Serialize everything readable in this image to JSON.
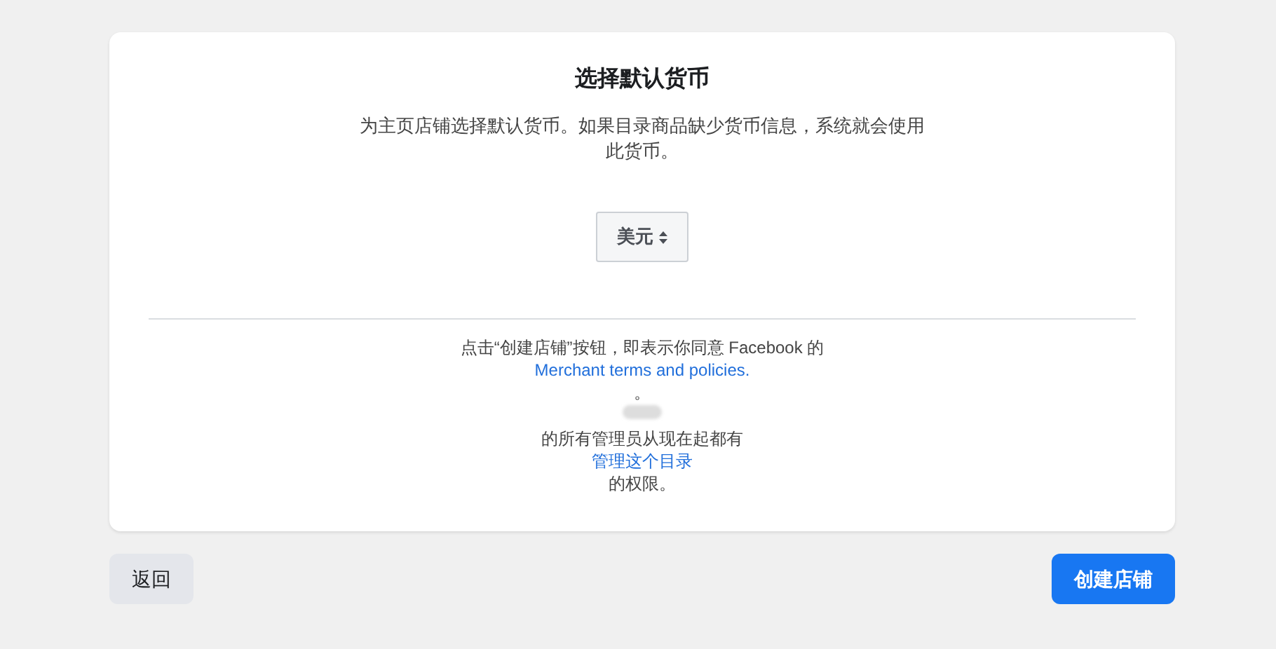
{
  "dialog": {
    "title": "选择默认货币",
    "description": "为主页店铺选择默认货币。如果目录商品缺少货币信息，系统就会使用此货币。",
    "currency_select": {
      "value": "美元"
    },
    "terms": [
      {
        "kind": "text",
        "text": "点击“创建店铺”按钮，即表示你同意 Facebook 的"
      },
      {
        "kind": "link",
        "text": "Merchant terms and policies."
      },
      {
        "kind": "text",
        "text": "。"
      },
      {
        "kind": "redacted"
      },
      {
        "kind": "text",
        "text": "的所有管理员从现在起都有"
      },
      {
        "kind": "link",
        "text": "管理这个目录"
      },
      {
        "kind": "text",
        "text": "的权限。"
      }
    ]
  },
  "buttons": [
    {
      "label": "返回",
      "kind": "secondary"
    },
    {
      "label": "创建店铺",
      "kind": "primary"
    }
  ]
}
